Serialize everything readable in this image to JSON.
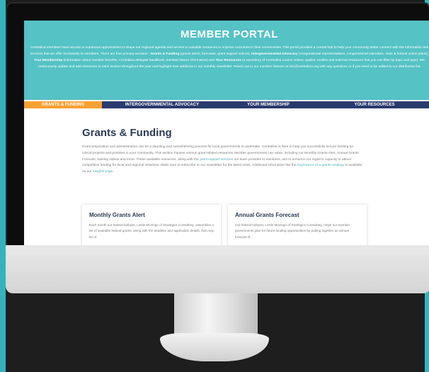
{
  "portal": {
    "title": "MEMBER PORTAL",
    "description_parts": [
      "Centralina members have access to numerous opportunities to shape our regional agenda and access to valuable resources to improve outcomes in their communities. This portal provides a central hub to help your community better connect with the information and services that we offer exclusively to members. There are four primary sections - ",
      "Grants & Funding",
      " (grants alerts, forecasts, grant support videos), ",
      "Intergovernmental Advocacy",
      " (congressional representatives, congressional calendars, state & federal action plans), ",
      "Your Membership",
      " (information about member benefits, Centralina delegate handbook, member liaison information) and ",
      "Your Resources",
      " (a repository of Centralina Learns videos, guides, toolkits and external resources that you can filter by topic and type). We continuously update and add resources to each section throughout the year and highlight new additions in our monthly newsletter. Reach out to our member liaisons at info@centralina.org with any questions or if you need to be added to our distribution list."
    ]
  },
  "nav": {
    "tabs": [
      {
        "label": "GRANTS & FUNDING",
        "active": true
      },
      {
        "label": "INTERGOVERNMENTAL ADVOCACY",
        "active": false
      },
      {
        "label": "YOUR MEMBERSHIP",
        "active": false
      },
      {
        "label": "YOUR RESOURCES",
        "active": false
      }
    ]
  },
  "section": {
    "title": "Grants & Funding",
    "body_1": "Grant preparation and administration can be a daunting and overwhelming process for local governments to undertake. Centralina is here to help you successfully secure funding for critical projects and priorities in your community. This section houses various grant-related resources member governments can value, including our Monthly Grants Alert, Annual Grants Forecast, training videos and more. These available resources, along with the ",
    "link_1": "grant support services",
    "body_2": " our team provides to members, aim to enhance our region's capacity to attract competitive funding for local and regional initiatives. Make sure to subscribe to our newsletter for the latest news. Additional information like the ",
    "link_2": "importance of a grants strategy",
    "body_3": " is available on our ",
    "link_3": "insights page",
    "body_4": "."
  },
  "cards": [
    {
      "title": "Monthly Grants Alert",
      "body": "Each month our federal lobbyist, Leslie Mozingo of Strategics Consulting, assembles a list of available federal grants, along with the deadline and application details, that may be of"
    },
    {
      "title": "Annual Grants Forecast",
      "body": "Our federal lobbyist, Leslie Mozingo of Strategics Consulting, helps our member governments plan for future funding opportunities by putting together an annual forecast of"
    }
  ],
  "colors": {
    "header_bg": "#55c2c5",
    "nav_bg": "#2a3a6e",
    "nav_active": "#f7a133",
    "title_text": "#2c3a55",
    "link": "#42b0b6"
  }
}
